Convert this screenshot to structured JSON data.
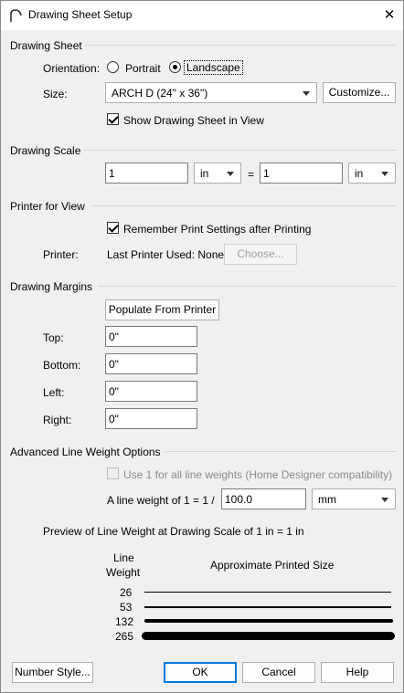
{
  "window": {
    "title": "Drawing Sheet Setup",
    "close_glyph": "✕"
  },
  "drawing_sheet": {
    "section": "Drawing Sheet",
    "orientation_label": "Orientation:",
    "portrait": "Portrait",
    "landscape": "Landscape",
    "size_label": "Size:",
    "size_value": "ARCH D  (24\" x 36\")",
    "customize": "Customize...",
    "show_sheet": "Show Drawing Sheet in View"
  },
  "drawing_scale": {
    "section": "Drawing Scale",
    "left_value": "1",
    "left_unit": "in",
    "equals": "=",
    "right_value": "1",
    "right_unit": "in"
  },
  "printer": {
    "section": "Printer for View",
    "remember": "Remember Print Settings after Printing",
    "printer_label": "Printer:",
    "last_printer": "Last Printer Used: None",
    "choose": "Choose..."
  },
  "margins": {
    "section": "Drawing Margins",
    "populate": "Populate From Printer",
    "top_label": "Top:",
    "top_value": "0\"",
    "bottom_label": "Bottom:",
    "bottom_value": "0\"",
    "left_label": "Left:",
    "left_value": "0\"",
    "right_label": "Right:",
    "right_value": "0\""
  },
  "advanced": {
    "section": "Advanced Line Weight Options",
    "use1": "Use 1 for all line weights (Home Designer compatibility)",
    "weight_label": "A line weight of 1 = 1 /",
    "weight_value": "100.0",
    "weight_unit": "mm",
    "preview_label": "Preview of Line Weight at Drawing Scale of  1 in = 1 in",
    "col_line_weight_1": "Line",
    "col_line_weight_2": "Weight",
    "col_printed": "Approximate Printed Size",
    "weights": [
      {
        "label": "26"
      },
      {
        "label": "53"
      },
      {
        "label": "132"
      },
      {
        "label": "265"
      }
    ]
  },
  "footer": {
    "number_style": "Number Style...",
    "ok": "OK",
    "cancel": "Cancel",
    "help": "Help"
  }
}
